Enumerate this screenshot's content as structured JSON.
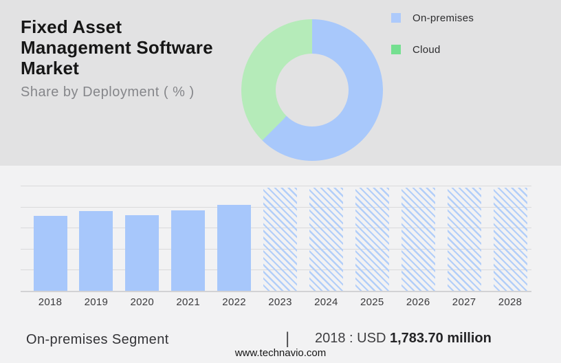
{
  "page": {
    "title": "Fixed Asset Management Software Market",
    "footer": "www.technavio.com"
  },
  "caption": {
    "segment_label": "On-premises Segment",
    "separator": "|",
    "value_prefix": "2018 : USD ",
    "value_bold": "1,783.70 million"
  },
  "colors": {
    "top_background": "#e2e2e3",
    "bottom_background": "#f2f2f3",
    "bar_blue": "#a7c7fb",
    "donut_blue": "#a8c8fb",
    "donut_green": "#b5ebb9",
    "legend_swatch_blue": "#adcafb",
    "legend_swatch_green": "#74df90",
    "hatch_stripe_blue": "#b2cef9",
    "gridline": "#d9d9db"
  },
  "chart_data": [
    {
      "type": "pie",
      "donut": true,
      "title": "Share by Deployment ( % )",
      "labels": [
        "On-premises",
        "Cloud"
      ],
      "values": [
        62.4,
        37.6
      ],
      "unit": "%",
      "slice_colors": [
        "#a8c8fb",
        "#b5ebb9"
      ],
      "legend_swatch_colors": [
        "#adcafb",
        "#74df90"
      ],
      "legend_position": "right",
      "start_angle": "12-oclock",
      "direction": "clockwise"
    },
    {
      "type": "bar",
      "categories": [
        "2018",
        "2019",
        "2020",
        "2021",
        "2022",
        "2023",
        "2024",
        "2025",
        "2026",
        "2027",
        "2028"
      ],
      "series": [
        {
          "name": "On-premises segment size (USD million)",
          "values": [
            1783.7,
            1898,
            1793,
            1906,
            2036,
            2455,
            2455,
            2455,
            2455,
            2455,
            2455
          ]
        }
      ],
      "labeled_value_note": "2018 : USD 1,783.70 million",
      "ylim": [
        0,
        2500
      ],
      "gridline_step": 500,
      "grid": true,
      "y_axis_labels_shown": false,
      "bar_color": "#a7c7fb",
      "forecast_start_category": "2023",
      "forecast_style": "diagonal-hatch",
      "hatch_color": "#b2cef9"
    }
  ]
}
